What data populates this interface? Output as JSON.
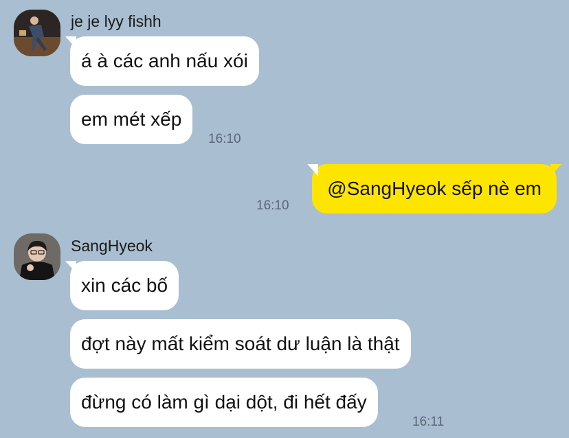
{
  "colors": {
    "background": "#a9bed1",
    "incoming_bubble": "#ffffff",
    "outgoing_bubble": "#fee500"
  },
  "groups": [
    {
      "sender": "je je lyy fishh",
      "avatar_icon": "user-photo-icon",
      "messages": [
        "á à các anh nấu xói",
        "em mét xếp"
      ],
      "time": "16:10"
    },
    {
      "sender": "SangHyeok",
      "avatar_icon": "user-photo-icon",
      "messages": [
        "xin các bố",
        "đợt này mất kiểm soát dư luận là thật",
        "đừng có làm gì dại dột, đi hết đấy"
      ],
      "time": "16:11"
    }
  ],
  "outgoing": {
    "message": "@SangHyeok sếp nè em",
    "time": "16:10"
  }
}
